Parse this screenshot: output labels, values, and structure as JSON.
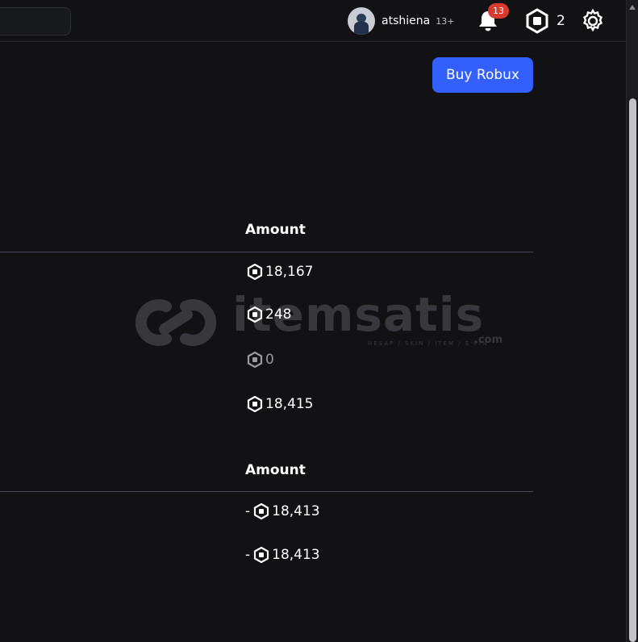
{
  "header": {
    "username": "atshiena",
    "age_badge": "13+",
    "notification_count": "13",
    "robux_balance": "2",
    "icons": [
      "avatar",
      "bell-icon",
      "robux-icon",
      "gear-icon"
    ]
  },
  "buy_button": "Buy Robux",
  "summary_table": {
    "column_header": "Amount",
    "amounts": [
      "18,167",
      "248",
      "0",
      "18,415"
    ]
  },
  "transactions_table": {
    "column_header": "Amount",
    "amounts": [
      {
        "sign": "-",
        "value": "18,413"
      },
      {
        "sign": "-",
        "value": "18,413"
      }
    ]
  },
  "watermark": {
    "brand": "itemsatis",
    "tagline": "HESAP / SKIN / ITEM / E-PIN",
    "suffix": ".com"
  },
  "colors": {
    "accent": "#335fff",
    "badge": "#d83a30",
    "background": "#121215"
  }
}
